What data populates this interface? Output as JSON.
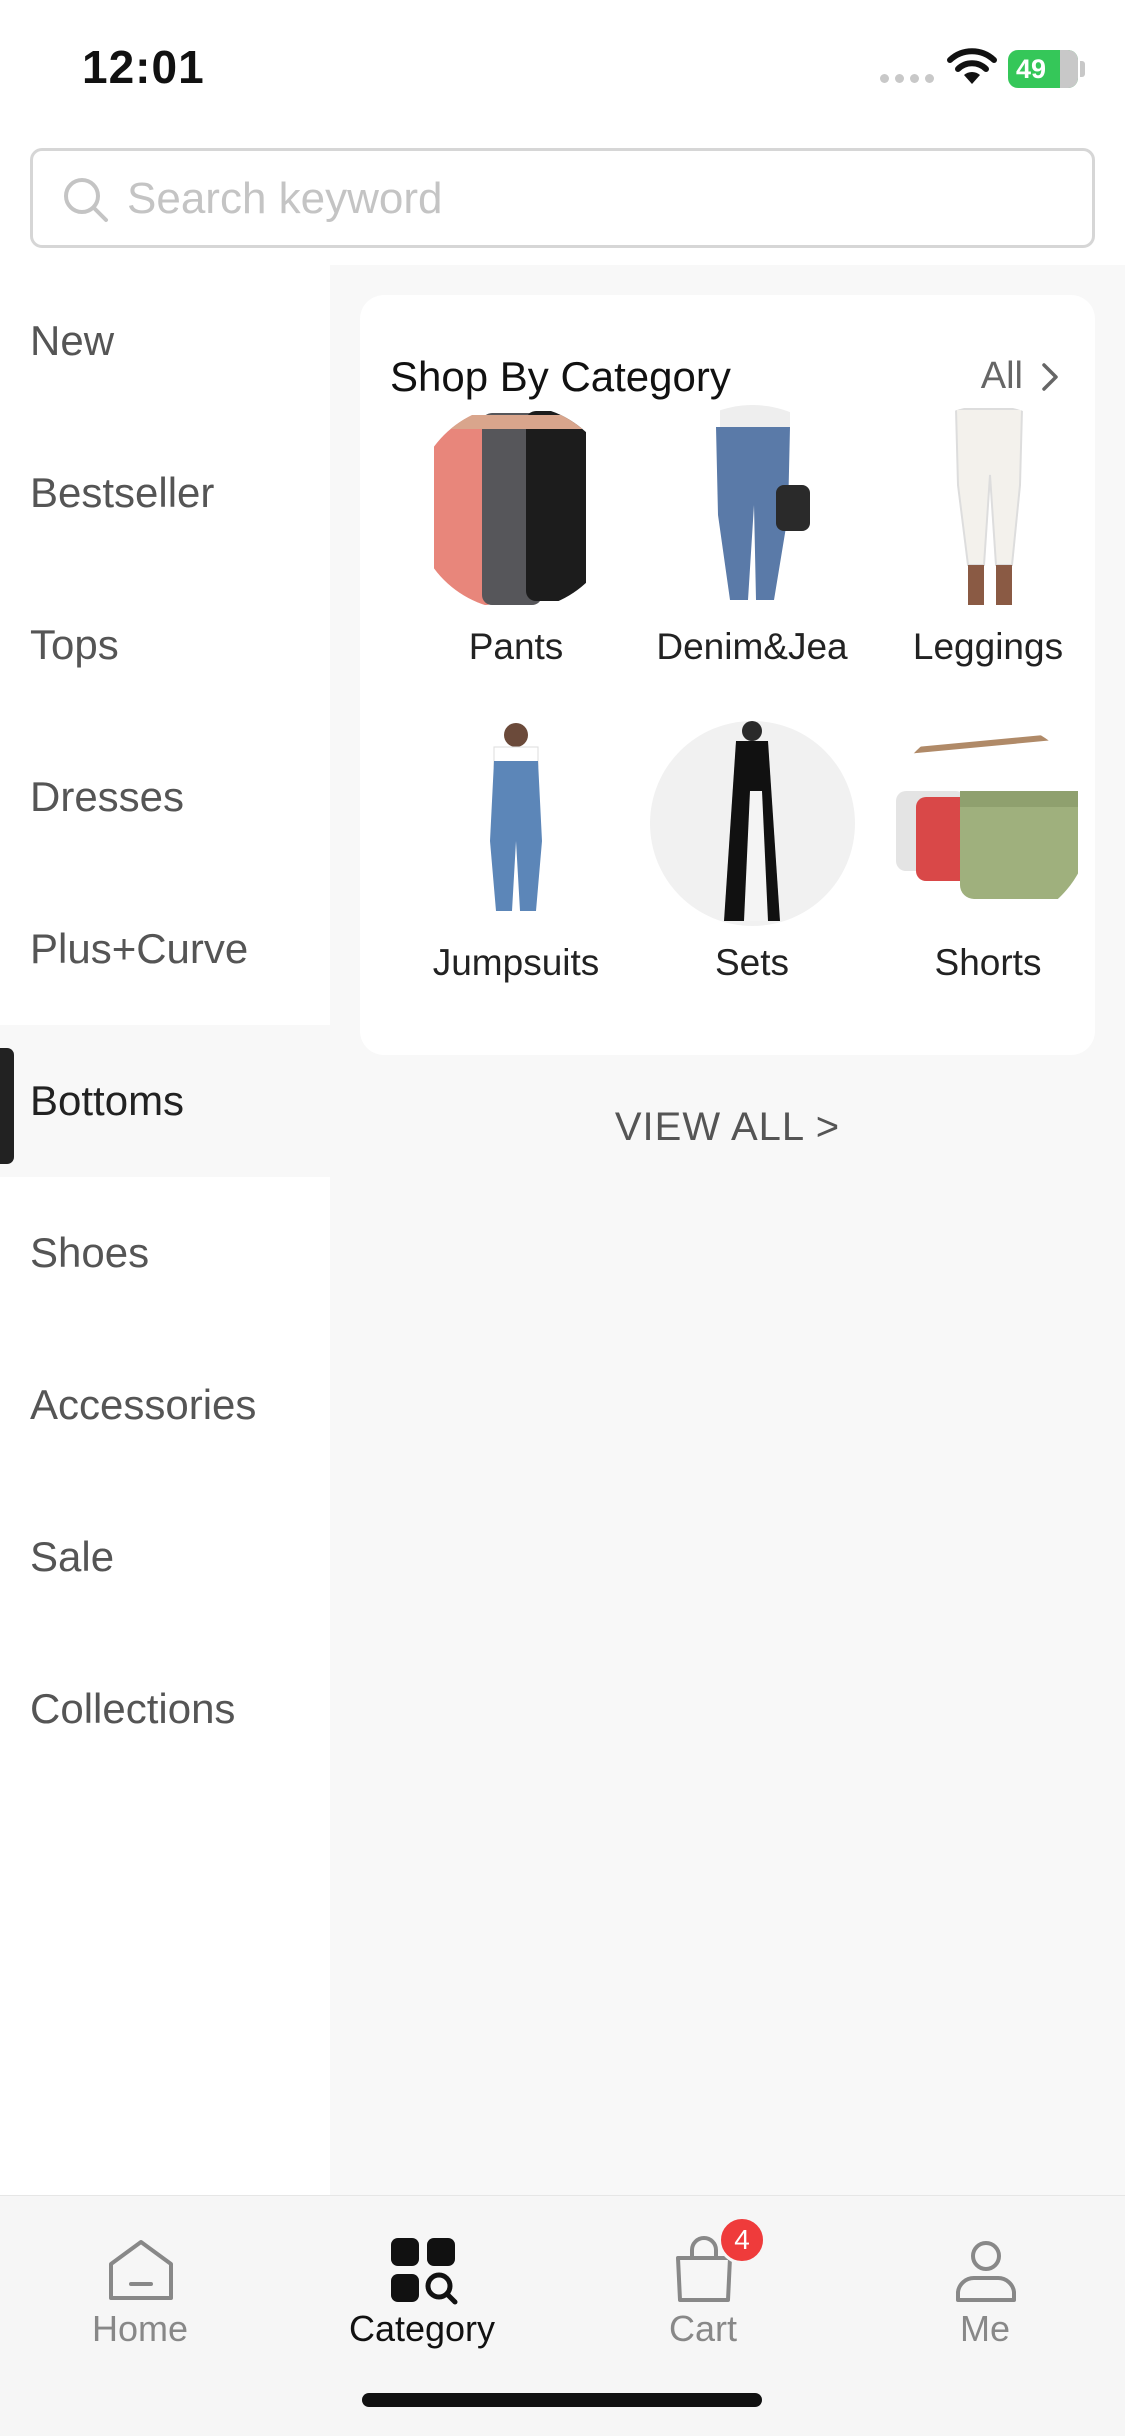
{
  "status_bar": {
    "time": "12:01",
    "battery": "49"
  },
  "search": {
    "placeholder": "Search keyword"
  },
  "sidebar": {
    "items": [
      {
        "label": "New"
      },
      {
        "label": "Bestseller"
      },
      {
        "label": "Tops"
      },
      {
        "label": "Dresses"
      },
      {
        "label": "Plus+Curve"
      },
      {
        "label": "Bottoms",
        "active": true
      },
      {
        "label": "Shoes"
      },
      {
        "label": "Accessories"
      },
      {
        "label": "Sale"
      },
      {
        "label": "Collections"
      }
    ]
  },
  "category_card": {
    "title": "Shop By Category",
    "all_label": "All",
    "items": [
      {
        "label": "Pants"
      },
      {
        "label": "Denim&Jea"
      },
      {
        "label": "Leggings"
      },
      {
        "label": "Jumpsuits"
      },
      {
        "label": "Sets"
      },
      {
        "label": "Shorts"
      }
    ]
  },
  "view_all": "VIEW ALL >",
  "tab_bar": {
    "tabs": [
      {
        "label": "Home",
        "icon": "home-icon"
      },
      {
        "label": "Category",
        "icon": "category-icon",
        "active": true
      },
      {
        "label": "Cart",
        "icon": "cart-icon",
        "badge": "4"
      },
      {
        "label": "Me",
        "icon": "profile-icon"
      }
    ]
  },
  "colors": {
    "accent": "#222222",
    "badge": "#ef3b3b",
    "battery": "#35c759"
  }
}
